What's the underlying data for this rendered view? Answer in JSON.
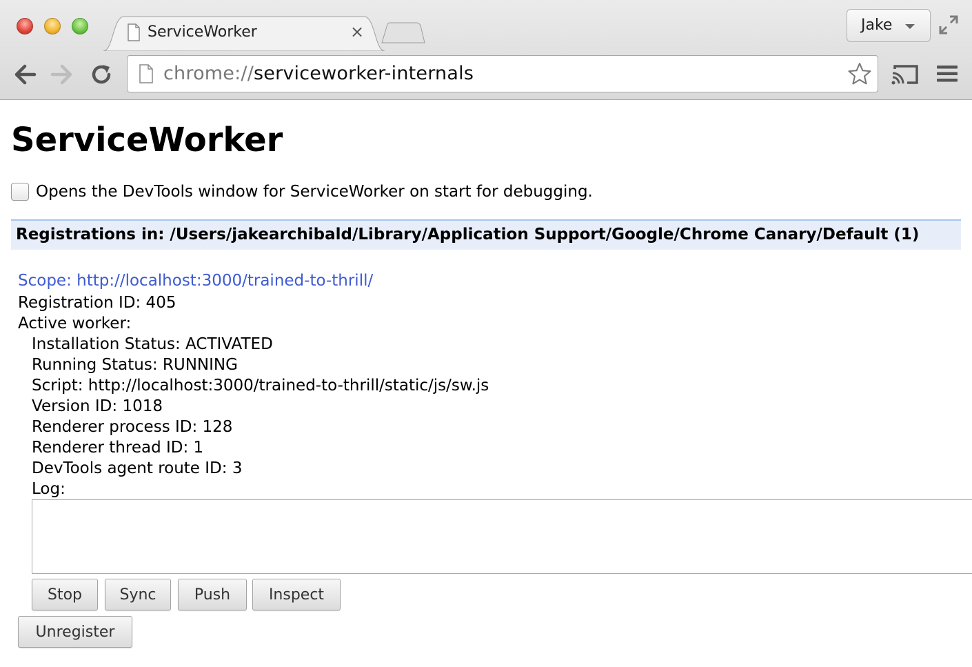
{
  "browser": {
    "tab_title": "ServiceWorker",
    "tab_close": "×",
    "profile_name": "Jake",
    "url_scheme": "chrome://",
    "url_path": "serviceworker-internals"
  },
  "page": {
    "title": "ServiceWorker",
    "devtools_option_label": "Opens the DevTools window for ServiceWorker on start for debugging.",
    "devtools_option_checked": false,
    "registrations_header": "Registrations in: /Users/jakearchibald/Library/Application Support/Google/Chrome Canary/Default (1)"
  },
  "registration": {
    "scope": "Scope: http://localhost:3000/trained-to-thrill/",
    "registration_id": "Registration ID: 405",
    "active_worker_label": "Active worker:",
    "installation_status": "Installation Status: ACTIVATED",
    "running_status": "Running Status: RUNNING",
    "script": "Script: http://localhost:3000/trained-to-thrill/static/js/sw.js",
    "version_id": "Version ID: 1018",
    "renderer_process_id": "Renderer process ID: 128",
    "renderer_thread_id": "Renderer thread ID: 1",
    "devtools_route_id": "DevTools agent route ID: 3",
    "log_label": "Log:",
    "log_content": "",
    "buttons": {
      "stop": "Stop",
      "sync": "Sync",
      "push": "Push",
      "inspect": "Inspect",
      "unregister": "Unregister"
    }
  },
  "icons": {
    "back": "back-arrow-icon",
    "forward": "forward-arrow-icon",
    "reload": "reload-icon",
    "page": "page-icon",
    "bookmark": "star-icon",
    "cast": "cast-icon",
    "menu": "hamburger-menu-icon",
    "fullscreen": "fullscreen-icon"
  }
}
